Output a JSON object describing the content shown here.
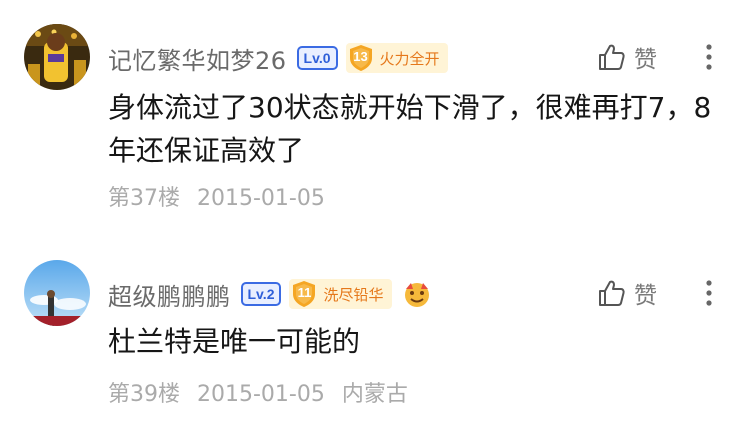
{
  "comments": [
    {
      "username": "记忆繁华如梦26",
      "level": "Lv.0",
      "fan_level": "13",
      "fan_title": "火力全开",
      "content": "身体流过了30状态就开始下滑了，很难再打7，8年还保证高效了",
      "floor": "第37楼",
      "date": "2015-01-05",
      "location": "",
      "like_label": "赞",
      "avatar_icon": "basketball-player-avatar",
      "badge_color": "#f5a623"
    },
    {
      "username": "超级鹏鹏鹏",
      "level": "Lv.2",
      "fan_level": "11",
      "fan_title": "洗尽铅华",
      "content": "杜兰特是唯一可能的",
      "floor": "第39楼",
      "date": "2015-01-05",
      "location": "内蒙古",
      "like_label": "赞",
      "avatar_icon": "sky-avatar",
      "badge_color": "#f5a623",
      "extra_badge_icon": "emoji-badge-icon"
    }
  ],
  "colors": {
    "level_badge": "#3b6be3",
    "fan_text": "#e5781b",
    "meta_text": "#aaaaaa",
    "username": "#6a6a6a"
  }
}
